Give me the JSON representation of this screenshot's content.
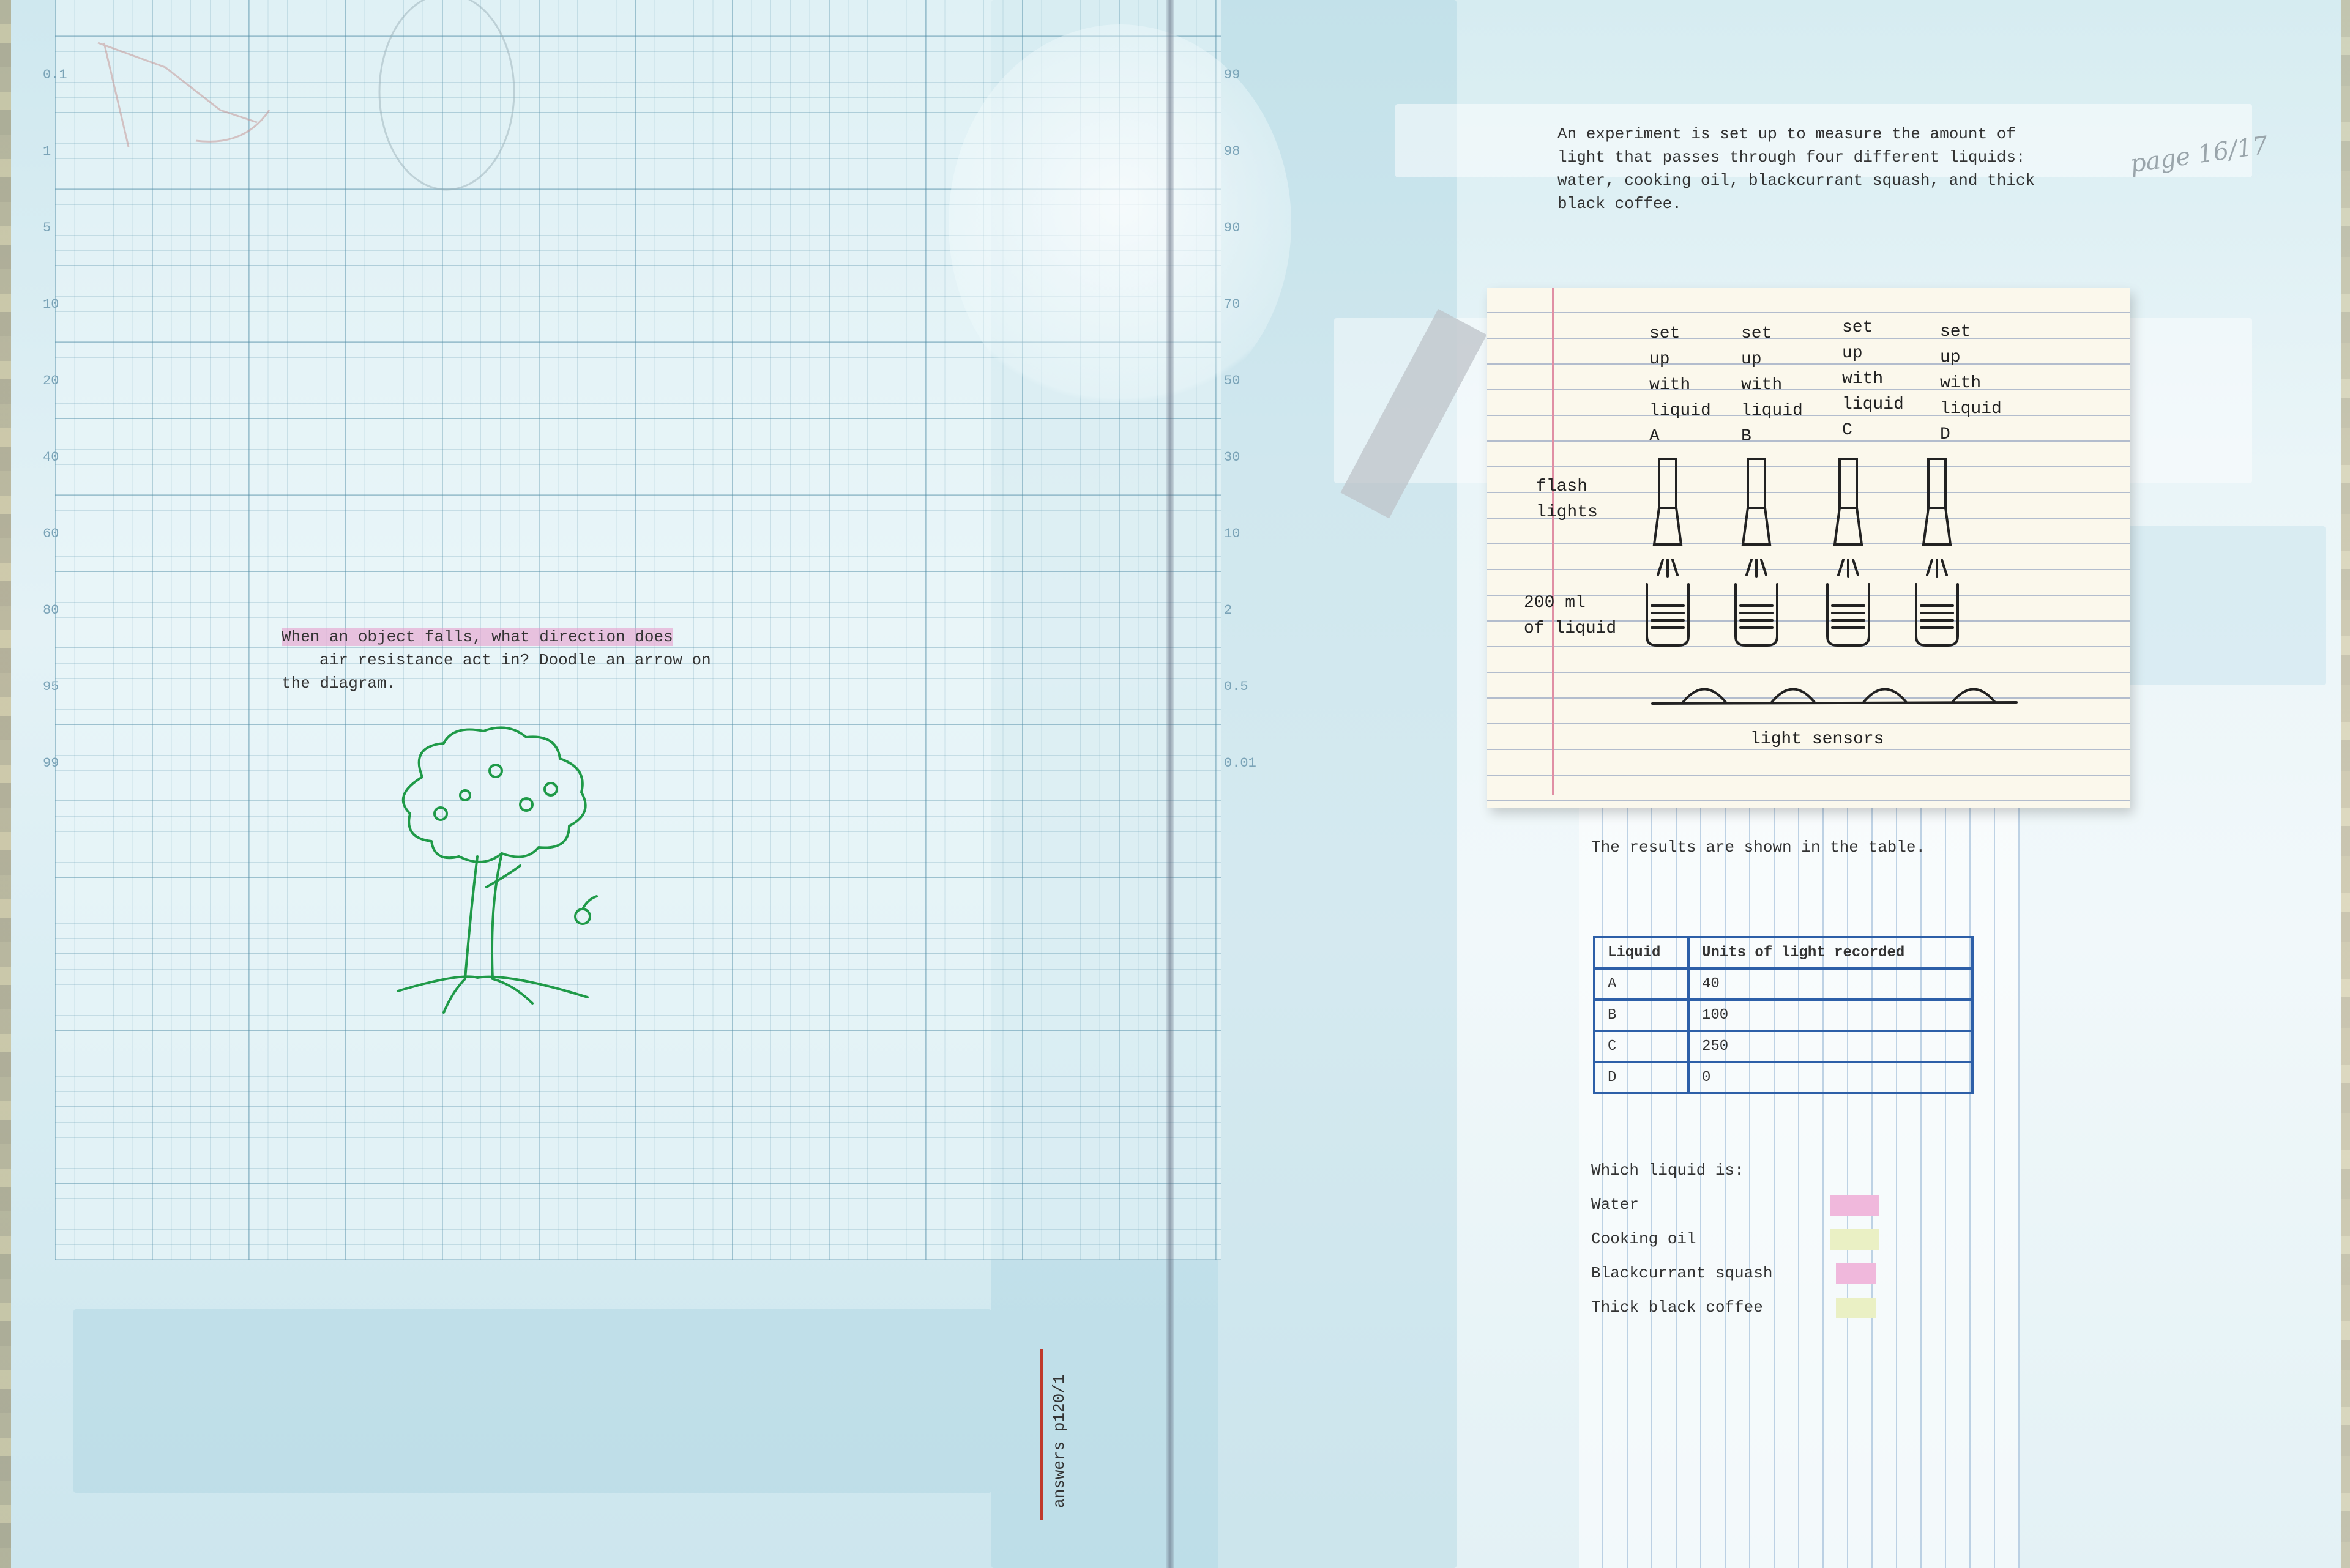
{
  "page": {
    "number": "16",
    "total": "17",
    "answers_ref": "answers p120/1"
  },
  "left": {
    "question_line1": "When an object falls, what direction does",
    "question_line2": "air resistance act in? Doodle an arrow on",
    "question_line3": "the diagram."
  },
  "right": {
    "intro_line1": "An experiment is set up to measure the amount of",
    "intro_line2": "light that passes through four different liquids:",
    "intro_line3": "water, cooking oil, blackcurrant squash, and thick",
    "intro_line4": "black coffee.",
    "diagram": {
      "setups": [
        {
          "label": "set\nup\nwith\nliquid\nA"
        },
        {
          "label": "set\nup\nwith\nliquid\nB"
        },
        {
          "label": "set\nup\nwith\nliquid\nC"
        },
        {
          "label": "set\nup\nwith\nliquid\nD"
        }
      ],
      "flash_label": "flash\nlights",
      "liquid_label": "200 ml\nof liquid",
      "sensors_label": "light sensors"
    },
    "results_text": "The results are shown in the table.",
    "table": {
      "headers": [
        "Liquid",
        "Units of light recorded"
      ],
      "rows": [
        [
          "A",
          "40"
        ],
        [
          "B",
          "100"
        ],
        [
          "C",
          "250"
        ],
        [
          "D",
          "0"
        ]
      ]
    },
    "which_prompt": "Which liquid is:",
    "which_items": [
      {
        "label": "Water",
        "color": "#f0b8dc"
      },
      {
        "label": "Cooking oil",
        "color": "#eaf0c4"
      },
      {
        "label": "Blackcurrant squash",
        "color": "#f0b8dc"
      },
      {
        "label": "Thick black coffee",
        "color": "#eaf0c4"
      }
    ]
  }
}
